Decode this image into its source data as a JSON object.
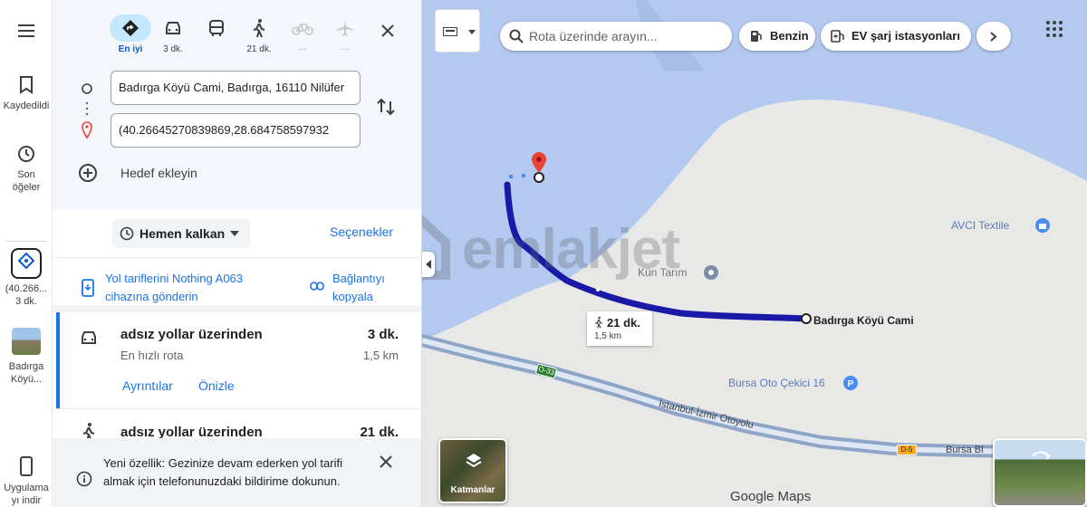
{
  "rail": {
    "saved_label": "Kaydedildi",
    "recents_label": "Son öğeler",
    "pinned1_line1": "(40.266...",
    "pinned1_line2": "3 dk.",
    "pinned2_line1": "Badırga",
    "pinned2_line2": "Köyü...",
    "app_label": "Uygulama yı indir",
    "icons": [
      "menu-icon",
      "bookmark-icon",
      "history-icon",
      "directions-diamond-icon",
      "phone-icon"
    ]
  },
  "modes": [
    {
      "label": "En iyi",
      "icon": "directions-diamond-icon"
    },
    {
      "label": "3 dk.",
      "icon": "car-icon"
    },
    {
      "label": "",
      "icon": "bus-icon"
    },
    {
      "label": "21 dk.",
      "icon": "walk-icon"
    },
    {
      "label": "—",
      "icon": "bicycle-icon"
    },
    {
      "label": "—",
      "icon": "plane-icon"
    }
  ],
  "origin": {
    "value": "Badırga Köyü Cami, Badırga, 16110 Nilüfer"
  },
  "destination": {
    "value": "(40.26645270839869,28.684758597932"
  },
  "add_destination": "Hedef ekleyin",
  "leave_now": "Hemen kalkan",
  "options": "Seçenekler",
  "send_to_device": {
    "line1": "Yol tariflerini Nothing A063",
    "line2": "cihazına gönderin"
  },
  "copy_link": {
    "line1": "Bağlantıyı",
    "line2": "kopyala"
  },
  "routes": [
    {
      "title": "adsız yollar üzerinden",
      "time": "3 dk.",
      "subtitle": "En hızlı rota",
      "distance": "1,5 km",
      "details": "Ayrıntılar",
      "preview": "Önizle"
    },
    {
      "title": "adsız yollar üzerinden",
      "time": "21 dk."
    }
  ],
  "banner": {
    "text": "Yeni özellik: Gezinize devam ederken yol tarifi almak için telefonunuzdaki bildirime dokunun."
  },
  "map": {
    "search_placeholder": "Rota üzerinde arayın...",
    "chips": [
      "Benzin",
      "EV şarj istasyonları"
    ],
    "place_avci": "AVCI Textile",
    "place_kun": "Kün Tarım",
    "place_badirga": "Badırga Köyü Cami",
    "place_bursa_oto": "Bursa Oto Çekici 16",
    "road_name": "İstanbul-İzmir Otoyolu",
    "road_shield1": "O-33",
    "road_shield2": "D-5",
    "road_bursa": "Bursa Bl",
    "walk_time": "21 dk.",
    "walk_dist": "1,5 km",
    "layers_label": "Katmanlar",
    "attribution": "Google Maps",
    "watermark": "emlakjet"
  },
  "colors": {
    "accent": "#0b57d0",
    "route": "#1a1aa6",
    "water": "#b3c9f0",
    "land": "#e8e8e6",
    "pin": "#ea4335"
  }
}
